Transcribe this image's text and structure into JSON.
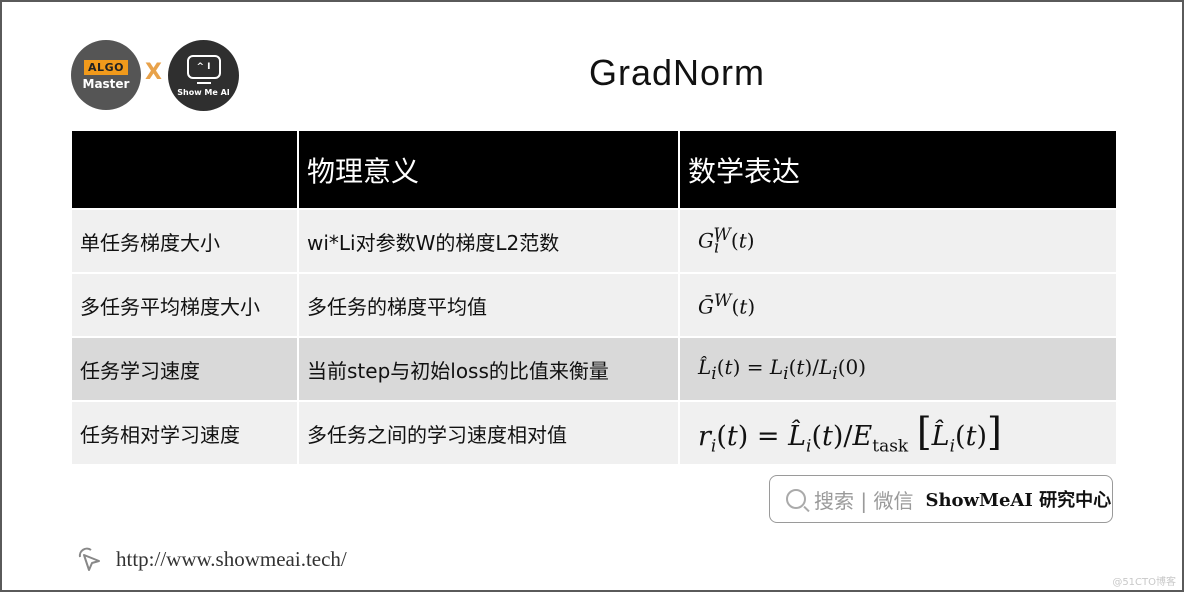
{
  "logos": {
    "algo_tag": "ALGO",
    "algo_master": "Master",
    "separator": "X",
    "show_screen": "^ I",
    "show_text": "Show Me AI"
  },
  "title": "GradNorm",
  "table": {
    "headers": [
      "",
      "物理意义",
      "数学表达"
    ],
    "rows": [
      {
        "name": "单任务梯度大小",
        "meaning": "wi*Li对参数W的梯度L2范数",
        "formula": "G_i^W(t)"
      },
      {
        "name": "多任务平均梯度大小",
        "meaning": "多任务的梯度平均值",
        "formula": "Ḡ^W(t)"
      },
      {
        "name": "任务学习速度",
        "meaning": "当前step与初始loss的比值来衡量",
        "formula": "L̂_i(t) = L_i(t)/L_i(0)"
      },
      {
        "name": "任务相对学习速度",
        "meaning": "多任务之间的学习速度相对值",
        "formula": "r_i(t) = L̂_i(t)/E_task[L̂_i(t)]"
      }
    ]
  },
  "search": {
    "hint": "搜索 | 微信",
    "brand": "ShowMeAI 研究中心"
  },
  "footer": {
    "url": "http://www.showmeai.tech/"
  },
  "watermark": "@51CTO博客",
  "colors": {
    "header_bg": "#000000",
    "row_light": "#f0f0f0",
    "row_dark": "#d9d9d9",
    "algo_orange": "#f19a1b"
  }
}
